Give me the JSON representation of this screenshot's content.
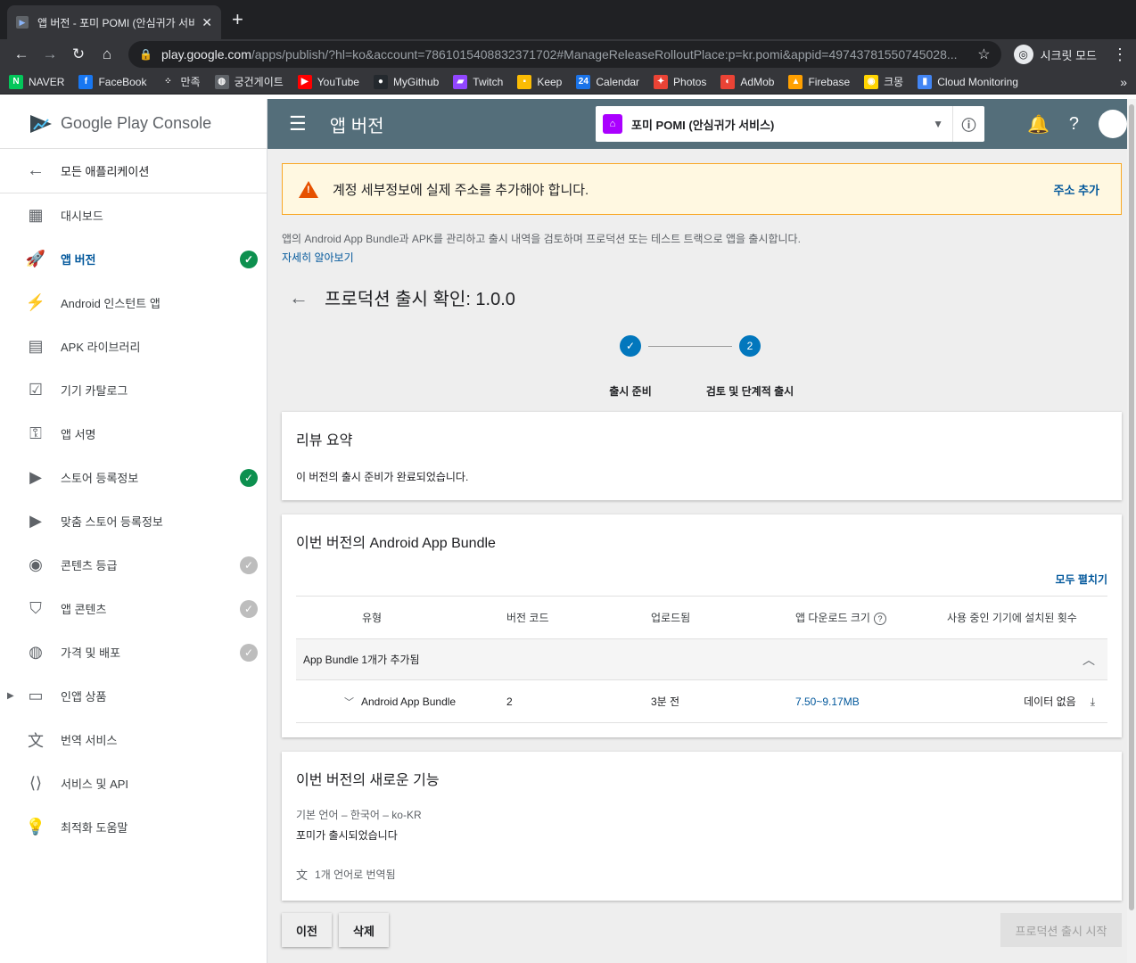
{
  "browser": {
    "tab_title": "앱 버전 - 포미 POMI (안심귀가 서비스",
    "url_host": "play.google.com",
    "url_path": "/apps/publish/?hl=ko&account=7861015408832371702#ManageReleaseRolloutPlace:p=kr.pomi&appid=49743781550745028...",
    "incognito_label": "시크릿 모드",
    "bookmarks": [
      {
        "label": "NAVER",
        "icon": "naver-icon",
        "color": "#03c75a",
        "glyph": "N"
      },
      {
        "label": "FaceBook",
        "icon": "facebook-icon",
        "color": "#1877f2",
        "glyph": "f"
      },
      {
        "label": "만족",
        "icon": "dots-icon",
        "color": "#35363a",
        "glyph": "⁘"
      },
      {
        "label": "궁건게이트",
        "icon": "globe-icon",
        "color": "#5f6368",
        "glyph": "◍"
      },
      {
        "label": "YouTube",
        "icon": "youtube-icon",
        "color": "#ff0000",
        "glyph": "▶"
      },
      {
        "label": "MyGithub",
        "icon": "github-icon",
        "color": "#24292e",
        "glyph": "●"
      },
      {
        "label": "Twitch",
        "icon": "twitch-icon",
        "color": "#9146ff",
        "glyph": "▰"
      },
      {
        "label": "Keep",
        "icon": "keep-icon",
        "color": "#fbbc04",
        "glyph": "▪"
      },
      {
        "label": "Calendar",
        "icon": "calendar-icon",
        "color": "#1a73e8",
        "glyph": "24"
      },
      {
        "label": "Photos",
        "icon": "photos-icon",
        "color": "#ea4335",
        "glyph": "✦"
      },
      {
        "label": "AdMob",
        "icon": "admob-icon",
        "color": "#ea4335",
        "glyph": "◐"
      },
      {
        "label": "Firebase",
        "icon": "firebase-icon",
        "color": "#ffa000",
        "glyph": "▲"
      },
      {
        "label": "크몽",
        "icon": "kmong-icon",
        "color": "#ffd400",
        "glyph": "◉"
      },
      {
        "label": "Cloud Monitoring",
        "icon": "monitoring-icon",
        "color": "#4285f4",
        "glyph": "▮"
      }
    ]
  },
  "sidebar": {
    "brand": "Google Play Console",
    "back_label": "모든 애플리케이션",
    "items": [
      {
        "label": "대시보드",
        "icon": "dashboard-icon",
        "glyph": "▦",
        "name": "sidebar-item-dashboard",
        "status": ""
      },
      {
        "label": "앱 버전",
        "icon": "rocket-icon",
        "glyph": "🚀",
        "name": "sidebar-item-app-releases",
        "status": "complete",
        "active": true
      },
      {
        "label": "Android 인스턴트 앱",
        "icon": "flash-icon",
        "glyph": "⚡",
        "name": "sidebar-item-instant-apps",
        "status": ""
      },
      {
        "label": "APK 라이브러리",
        "icon": "library-icon",
        "glyph": "▤",
        "name": "sidebar-item-apk-library",
        "status": ""
      },
      {
        "label": "기기 카탈로그",
        "icon": "device-catalog-icon",
        "glyph": "☑",
        "name": "sidebar-item-device-catalog",
        "status": ""
      },
      {
        "label": "앱 서명",
        "icon": "key-icon",
        "glyph": "⚿",
        "name": "sidebar-item-app-signing",
        "status": ""
      },
      {
        "label": "스토어 등록정보",
        "icon": "store-icon",
        "glyph": "▶",
        "name": "sidebar-item-store-listing",
        "status": "complete"
      },
      {
        "label": "맞춤 스토어 등록정보",
        "icon": "custom-store-icon",
        "glyph": "▶",
        "name": "sidebar-item-custom-store-listing",
        "status": ""
      },
      {
        "label": "콘텐츠 등급",
        "icon": "content-rating-icon",
        "glyph": "◉",
        "name": "sidebar-item-content-rating",
        "status": "grey"
      },
      {
        "label": "앱 콘텐츠",
        "icon": "shield-icon",
        "glyph": "⛉",
        "name": "sidebar-item-app-content",
        "status": "grey"
      },
      {
        "label": "가격 및 배포",
        "icon": "globe-icon",
        "glyph": "◍",
        "name": "sidebar-item-pricing",
        "status": "grey"
      },
      {
        "label": "인앱 상품",
        "icon": "credit-card-icon",
        "glyph": "▭",
        "name": "sidebar-item-in-app-products",
        "status": "",
        "caret": true
      },
      {
        "label": "번역 서비스",
        "icon": "translate-icon",
        "glyph": "文",
        "name": "sidebar-item-translation",
        "status": ""
      },
      {
        "label": "서비스 및 API",
        "icon": "api-icon",
        "glyph": "⟨⟩",
        "name": "sidebar-item-services-api",
        "status": ""
      },
      {
        "label": "최적화 도움말",
        "icon": "lightbulb-icon",
        "glyph": "💡",
        "name": "sidebar-item-optimization-tips",
        "status": ""
      }
    ]
  },
  "appbar": {
    "title": "앱 버전",
    "app_name": "포미 POMI (안심귀가 서비스)"
  },
  "warning": {
    "text": "계정 세부정보에 실제 주소를 추가해야 합니다.",
    "link": "주소 추가"
  },
  "intro": {
    "text": "앱의 Android App Bundle과 APK를 관리하고 출시 내역을 검토하며 프로덕션 또는 테스트 트랙으로 앱을 출시합니다.",
    "link": "자세히 알아보기"
  },
  "page": {
    "title": "프로덕션 출시 확인: 1.0.0"
  },
  "stepper": {
    "steps": [
      {
        "label": "출시 준비",
        "marker": "✓"
      },
      {
        "label": "검토 및 단계적 출시",
        "marker": "2"
      }
    ]
  },
  "review": {
    "title": "리뷰 요약",
    "text": "이 버전의 출시 준비가 완료되었습니다."
  },
  "bundles": {
    "title": "이번 버전의 Android App Bundle",
    "expand_all": "모두 펼치기",
    "columns": [
      "유형",
      "버전 코드",
      "업로드됨",
      "앱 다운로드 크기",
      "사용 중인 기기에 설치된 횟수"
    ],
    "group_label": "App Bundle 1개가 추가됨",
    "rows": [
      {
        "type": "Android App Bundle",
        "version_code": "2",
        "uploaded": "3분 전",
        "download_size": "7.50~9.17MB",
        "installs": "데이터 없음"
      }
    ]
  },
  "whats_new": {
    "title": "이번 버전의 새로운 기능",
    "language": "기본 언어 – 한국어 – ko-KR",
    "notes": "포미가 출시되었습니다",
    "translated": "1개 언어로 번역됨"
  },
  "actions": {
    "prev": "이전",
    "delete": "삭제",
    "start": "프로덕션 출시 시작"
  }
}
